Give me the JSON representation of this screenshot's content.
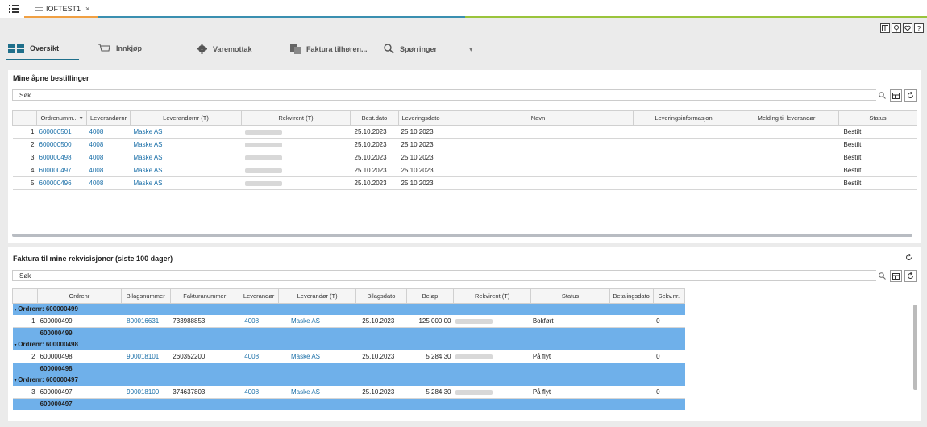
{
  "window": {
    "tab_title": "IOFTEST1",
    "tab_close": "×"
  },
  "colors": {
    "accent": "#1f6f8b",
    "link": "#1a6fa8",
    "group_row": "#6fb0ea",
    "line_orange": "#f0a043",
    "line_teal": "#3a8fb0",
    "line_green": "#9ac43c"
  },
  "toolbar_icons": [
    "layout-icon",
    "lightbulb-icon",
    "heart-icon",
    "help-icon"
  ],
  "toolbar_glyphs": {
    "help": "?"
  },
  "nav": {
    "tabs": [
      {
        "label": "Oversikt",
        "icon": "dashboard-icon"
      },
      {
        "label": "Innkjøp",
        "icon": "cart-icon"
      },
      {
        "label": "Varemottak",
        "icon": "gear-icon"
      },
      {
        "label": "Faktura tilhøren...",
        "icon": "invoice-icon"
      },
      {
        "label": "Spørringer",
        "icon": "search-icon"
      }
    ],
    "more": "▾"
  },
  "orders_panel": {
    "title": "Mine åpne bestillinger",
    "search_placeholder": "Søk",
    "columns": [
      "Ordrenumm...",
      "Leverandørnr",
      "Leverandørnr (T)",
      "Rekvirent (T)",
      "Best.dato",
      "Leveringsdato",
      "Navn",
      "Leveringsinformasjon",
      "Melding til leverandør",
      "Status"
    ],
    "rows": [
      {
        "n": "1",
        "order": "600000501",
        "supplier": "4008",
        "supplier_name": "Maske AS",
        "best_date": "25.10.2023",
        "delivery_date": "25.10.2023",
        "status": "Bestilt"
      },
      {
        "n": "2",
        "order": "600000500",
        "supplier": "4008",
        "supplier_name": "Maske AS",
        "best_date": "25.10.2023",
        "delivery_date": "25.10.2023",
        "status": "Bestilt"
      },
      {
        "n": "3",
        "order": "600000498",
        "supplier": "4008",
        "supplier_name": "Maske AS",
        "best_date": "25.10.2023",
        "delivery_date": "25.10.2023",
        "status": "Bestilt"
      },
      {
        "n": "4",
        "order": "600000497",
        "supplier": "4008",
        "supplier_name": "Maske AS",
        "best_date": "25.10.2023",
        "delivery_date": "25.10.2023",
        "status": "Bestilt"
      },
      {
        "n": "5",
        "order": "600000496",
        "supplier": "4008",
        "supplier_name": "Maske AS",
        "best_date": "25.10.2023",
        "delivery_date": "25.10.2023",
        "status": "Bestilt"
      }
    ]
  },
  "invoice_panel": {
    "title": "Faktura til mine rekvisisjoner (siste 100 dager)",
    "search_placeholder": "Søk",
    "columns": [
      "Ordrenr",
      "Bilagsnummer",
      "Fakturanummer",
      "Leverandør",
      "Leverandør (T)",
      "Bilagsdato",
      "Beløp",
      "Rekvirent (T)",
      "Status",
      "Betalingsdato",
      "Sekv.nr."
    ],
    "groups": [
      {
        "header": "Ordrenr: 600000499",
        "footer": "600000499",
        "row": {
          "n": "1",
          "order": "600000499",
          "voucher": "800016631",
          "invoice": "733988853",
          "supplier": "4008",
          "supplier_name": "Maske AS",
          "date": "25.10.2023",
          "amount": "125 000,00",
          "status": "Bokført",
          "seq": "0"
        }
      },
      {
        "header": "Ordrenr: 600000498",
        "footer": "600000498",
        "row": {
          "n": "2",
          "order": "600000498",
          "voucher": "900018101",
          "invoice": "260352200",
          "supplier": "4008",
          "supplier_name": "Maske AS",
          "date": "25.10.2023",
          "amount": "5 284,30",
          "status": "På flyt",
          "seq": "0"
        }
      },
      {
        "header": "Ordrenr: 600000497",
        "footer": "600000497",
        "row": {
          "n": "3",
          "order": "600000497",
          "voucher": "900018100",
          "invoice": "374637803",
          "supplier": "4008",
          "supplier_name": "Maske AS",
          "date": "25.10.2023",
          "amount": "5 284,30",
          "status": "På flyt",
          "seq": "0"
        }
      }
    ]
  }
}
